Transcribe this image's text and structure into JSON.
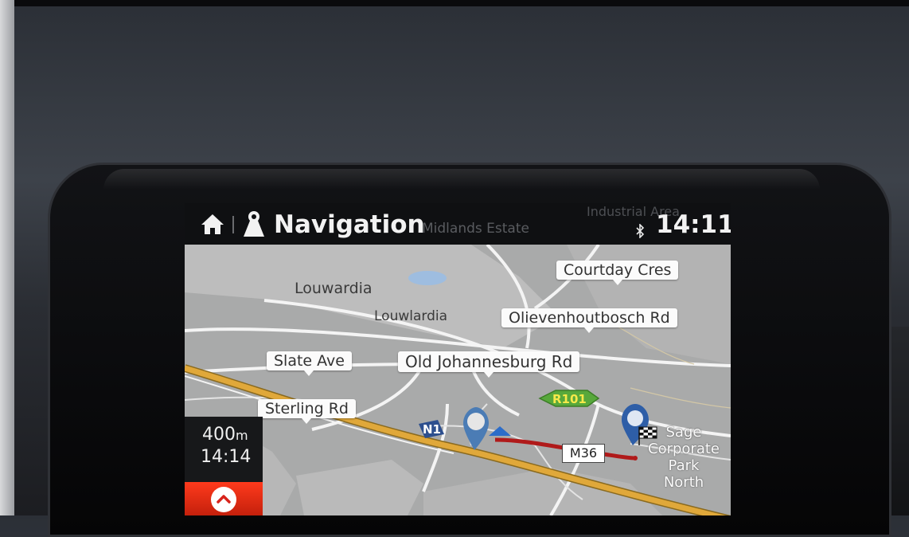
{
  "header": {
    "title": "Navigation",
    "clock": "14:11",
    "ghost_labels": [
      "Midlands Estate",
      "Industrial Area"
    ]
  },
  "map_labels": {
    "callouts": [
      {
        "id": "courtday",
        "text": "Courtday Cres"
      },
      {
        "id": "olieven",
        "text": "Olievenhoutbosch Rd"
      },
      {
        "id": "slate",
        "text": "Slate Ave"
      },
      {
        "id": "oldjhb",
        "text": "Old Johannesburg Rd"
      },
      {
        "id": "sterling",
        "text": "Sterling Rd"
      }
    ],
    "areas": [
      {
        "id": "louwardia",
        "text": "Louwardia"
      },
      {
        "id": "louwlardia",
        "text": "Louwlardia"
      }
    ],
    "sage_lines": [
      "Sage",
      "Corporate",
      "Park",
      "North"
    ],
    "shields": {
      "r101": "R101",
      "n1": "N1",
      "m36": "M36"
    }
  },
  "guidance": {
    "distance_value": "400",
    "distance_unit": "m",
    "eta": "14:14"
  },
  "colors": {
    "route": "#b01a1a",
    "highway": "#e0a83a",
    "header_bg": "#0f1012",
    "accent_button": "#e62a12"
  },
  "icons": [
    "home-icon",
    "navigation-icon",
    "bluetooth-icon",
    "fuel-station-icon",
    "vehicle-position-icon",
    "destination-flag-icon",
    "chevron-up-icon"
  ]
}
